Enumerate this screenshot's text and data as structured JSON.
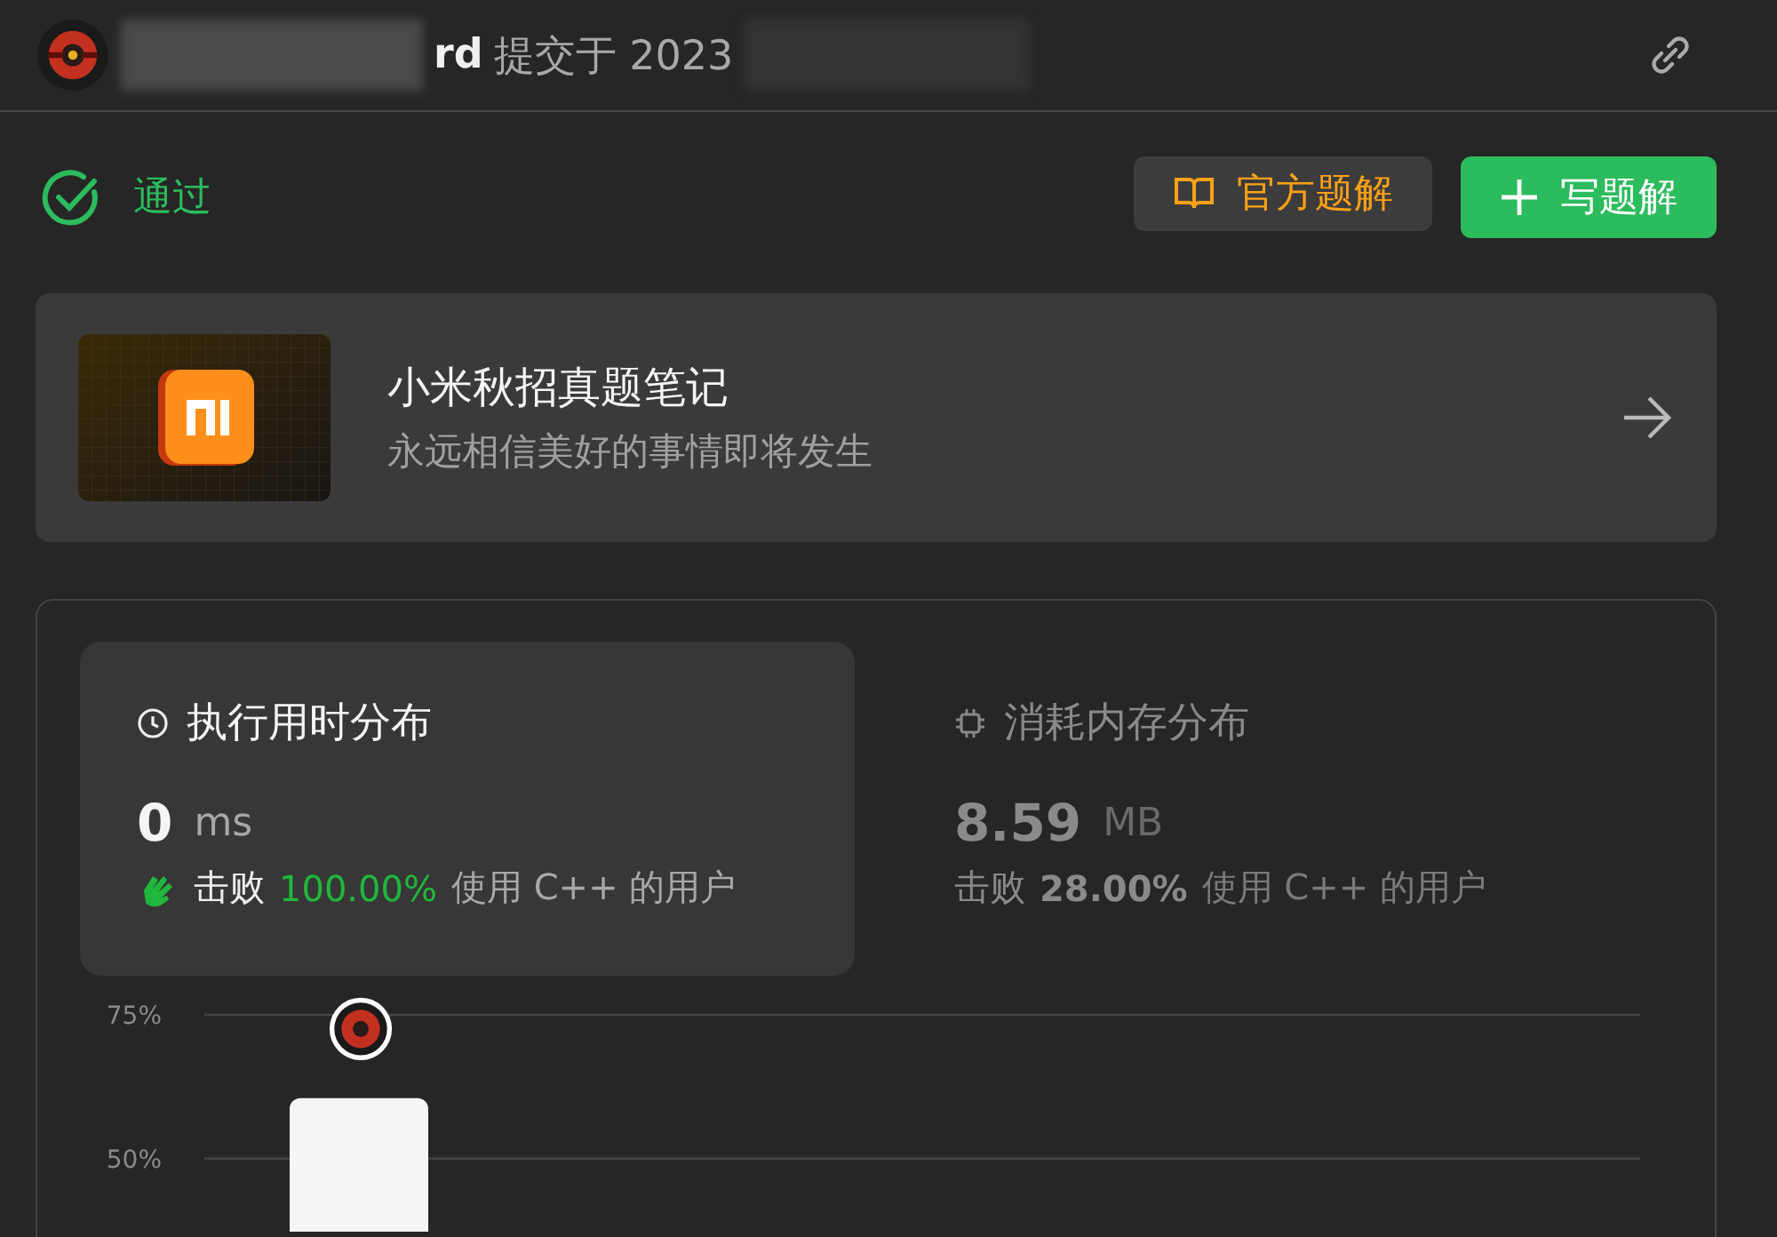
{
  "header": {
    "author_visible": "rd",
    "submitted": "提交于 2023"
  },
  "status": {
    "label": "通过",
    "accepted": true
  },
  "buttons": [
    {
      "kind": "secondary",
      "label": "官方题解"
    },
    {
      "kind": "primary",
      "label": "写题解"
    }
  ],
  "banner": {
    "title": "小米秋招真题笔记",
    "subtitle": "永远相信美好的事情即将发生"
  },
  "stats": [
    {
      "kind": "time",
      "selected": true,
      "title": "执行用时分布",
      "value": "0",
      "unit": "ms",
      "beat": "击败",
      "percent": "100.00%",
      "suffix": "使用 C++ 的用户"
    },
    {
      "kind": "memory",
      "selected": false,
      "title": "消耗内存分布",
      "value": "8.59",
      "unit": "MB",
      "beat": "击败",
      "percent": "28.00%",
      "suffix": "使用 C++ 的用户"
    }
  ],
  "chart": {
    "chart_data": {
      "type": "bar",
      "values": [
        60.5
      ],
      "ylim": [
        37.3,
        75
      ],
      "yticks": [
        {
          "value": 75,
          "label": "75%"
        },
        {
          "value": 50,
          "label": "50%"
        }
      ]
    }
  }
}
